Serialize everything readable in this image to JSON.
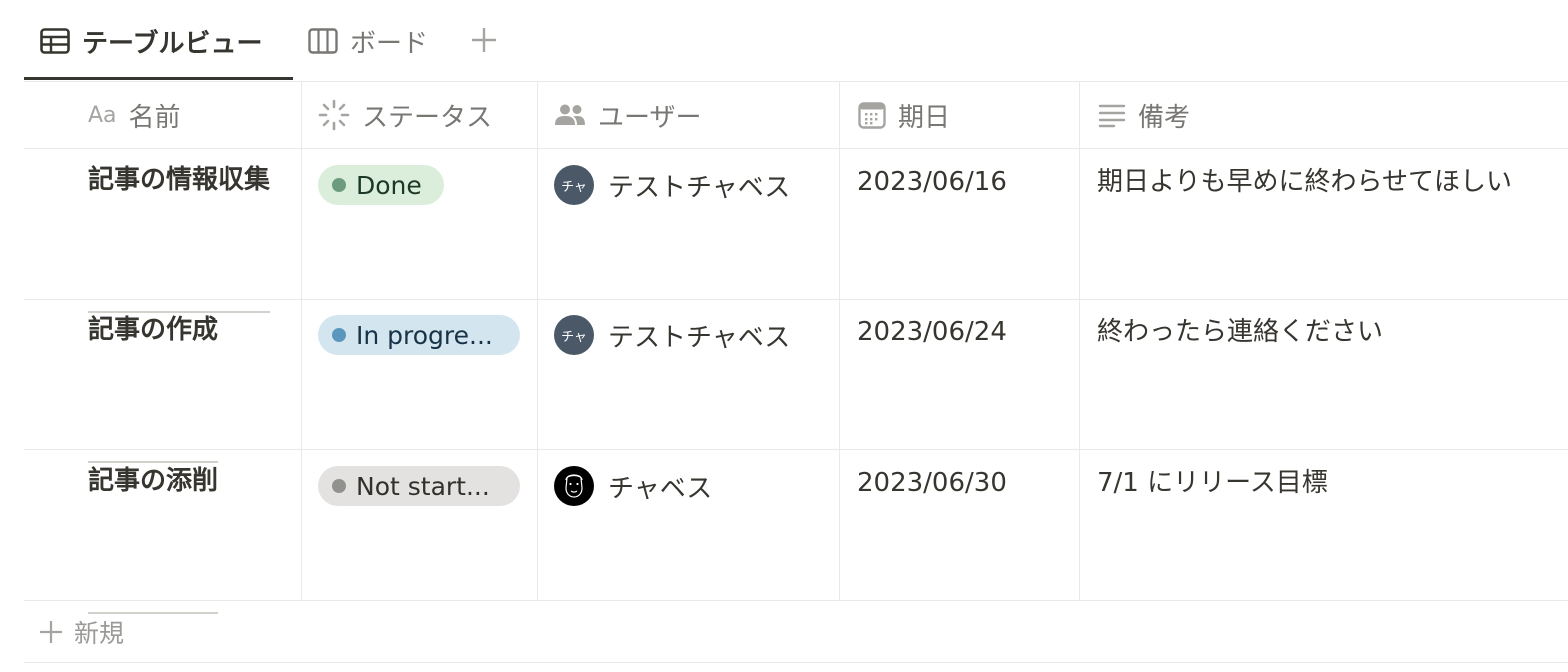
{
  "tabs": [
    {
      "label": "テーブルビュー",
      "icon": "table-icon",
      "active": true
    },
    {
      "label": "ボード",
      "icon": "board-icon",
      "active": false
    }
  ],
  "add_view_label": "+",
  "columns": [
    {
      "label": "名前",
      "icon": "text-type-icon",
      "icon_text": "Aa"
    },
    {
      "label": "ステータス",
      "icon": "status-icon"
    },
    {
      "label": "ユーザー",
      "icon": "people-icon"
    },
    {
      "label": "期日",
      "icon": "calendar-icon"
    },
    {
      "label": "備考",
      "icon": "text-lines-icon"
    }
  ],
  "rows": [
    {
      "name": "記事の情報収集",
      "status": "Done",
      "user": {
        "name": "テストチャベス",
        "avatar_text": "チャ"
      },
      "date": "2023/06/16",
      "note": "期日よりも早めに終わらせてほしい"
    },
    {
      "name": "記事の作成",
      "status": "In progre...",
      "user": {
        "name": "テストチャベス",
        "avatar_text": "チャ"
      },
      "date": "2023/06/24",
      "note": "終わったら連絡ください"
    },
    {
      "name": "記事の添削",
      "status": "Not start...",
      "user": {
        "name": "チャベス",
        "avatar_text": ""
      },
      "date": "2023/06/30",
      "note": "7/1 にリリース目標"
    }
  ],
  "new_row_label": "新規",
  "colors": {
    "text": "#37352f",
    "muted": "#787774",
    "border": "#e9e9e7",
    "done_bg": "#dbeddb",
    "progress_bg": "#d3e5ef",
    "not_started_bg": "#e3e2e0"
  }
}
